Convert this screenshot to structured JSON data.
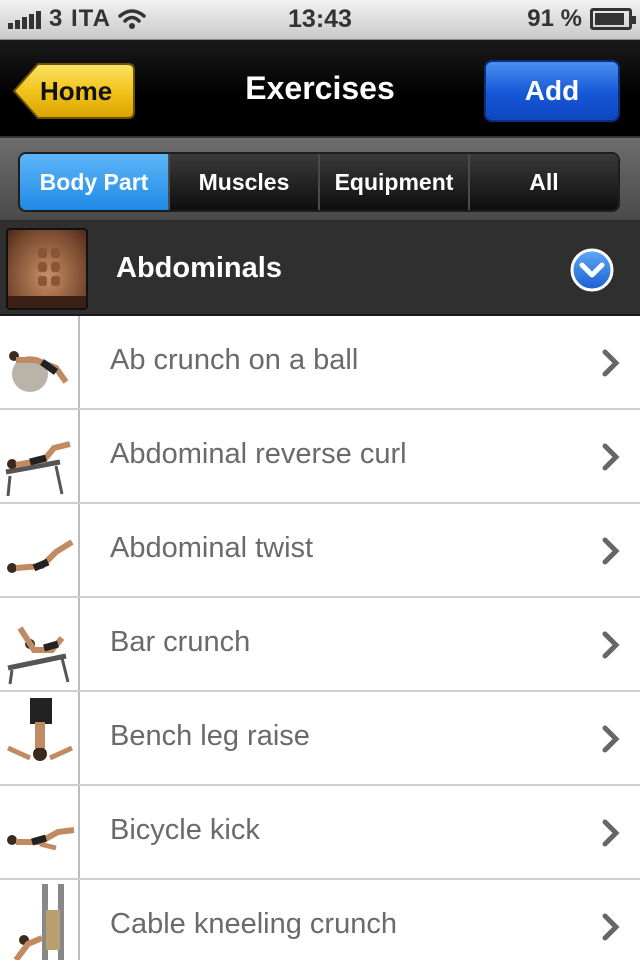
{
  "status_bar": {
    "carrier": "3 ITA",
    "time": "13:43",
    "battery": "91 %",
    "battery_level": 0.91
  },
  "nav": {
    "back_label": "Home",
    "title": "Exercises",
    "add_label": "Add"
  },
  "segments": {
    "items": [
      {
        "label": "Body Part",
        "active": true
      },
      {
        "label": "Muscles",
        "active": false
      },
      {
        "label": "Equipment",
        "active": false
      },
      {
        "label": "All",
        "active": false
      }
    ]
  },
  "category": {
    "title": "Abdominals",
    "toggle_icon": "chevron-down-circle-icon"
  },
  "exercises": [
    {
      "label": "Ab crunch on a ball"
    },
    {
      "label": "Abdominal reverse curl"
    },
    {
      "label": "Abdominal twist"
    },
    {
      "label": "Bar crunch"
    },
    {
      "label": "Bench leg raise"
    },
    {
      "label": "Bicycle kick"
    },
    {
      "label": "Cable kneeling crunch"
    }
  ],
  "colors": {
    "home_button": "#f3c51c",
    "add_button": "#1f5fd8",
    "segment_active": "#2b93ea",
    "row_text": "#6a6a6a"
  }
}
